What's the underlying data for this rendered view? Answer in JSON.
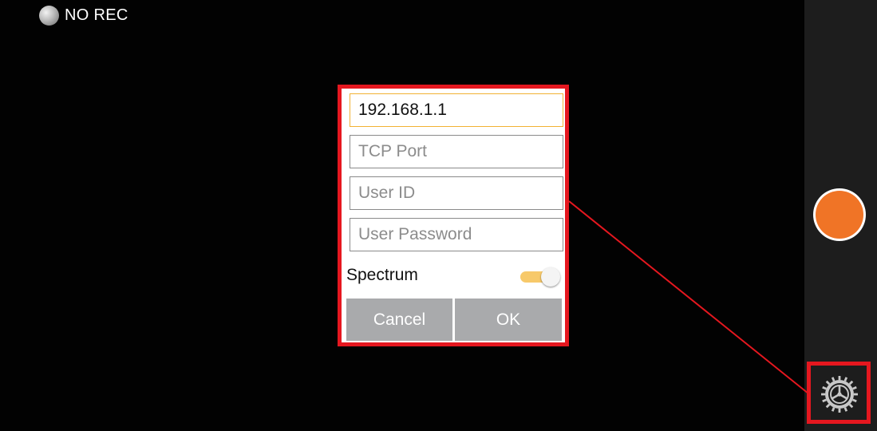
{
  "status": {
    "label": "NO REC"
  },
  "dialog": {
    "ip_value": "192.168.1.1",
    "tcp_port_placeholder": "TCP Port",
    "user_id_placeholder": "User ID",
    "password_placeholder": "User Password",
    "spectrum_label": "Spectrum",
    "spectrum_on": true,
    "cancel_label": "Cancel",
    "ok_label": "OK"
  },
  "sidebar": {
    "icons": [
      "info-icon",
      "switch-camera-icon",
      "flash-off-icon",
      "record-button",
      "settings-gear-icon"
    ]
  },
  "colors": {
    "highlight": "#e5171f",
    "record": "#f07426",
    "toggle_track": "#f7c96a",
    "button": "#a9aaac",
    "active_field_border": "#f2b233"
  }
}
